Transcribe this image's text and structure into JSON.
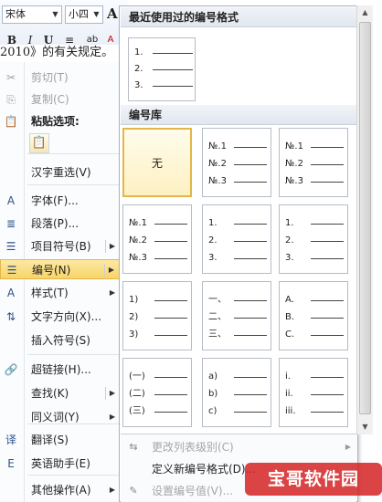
{
  "mini_toolbar": {
    "font": "宋体",
    "size": "小四",
    "grow_font": "A",
    "bold": "B",
    "italic": "I",
    "underline": "U",
    "center": "≡",
    "highlight": "ab",
    "font_color": "A"
  },
  "document": {
    "text": "2010》的有关规定。"
  },
  "context_menu": {
    "items": [
      {
        "label": "剪切(T)",
        "icon": "scissors-icon",
        "glyph": "✂"
      },
      {
        "label": "复制(C)",
        "icon": "copy-icon",
        "glyph": "⎘"
      },
      {
        "label": "粘贴选项:",
        "icon": "clipboard-icon",
        "glyph": "📋"
      },
      {
        "label": "汉字重选(V)",
        "icon": "",
        "glyph": ""
      },
      {
        "label": "字体(F)...",
        "icon": "font-icon",
        "glyph": "A"
      },
      {
        "label": "段落(P)...",
        "icon": "paragraph-icon",
        "glyph": "≣"
      },
      {
        "label": "项目符号(B)",
        "icon": "bullets-icon",
        "glyph": "☰"
      },
      {
        "label": "编号(N)",
        "icon": "numbering-icon",
        "glyph": "☰"
      },
      {
        "label": "样式(T)",
        "icon": "styles-icon",
        "glyph": "A"
      },
      {
        "label": "文字方向(X)...",
        "icon": "text-direction-icon",
        "glyph": "⇅"
      },
      {
        "label": "插入符号(S)",
        "icon": "",
        "glyph": ""
      },
      {
        "label": "超链接(H)...",
        "icon": "hyperlink-icon",
        "glyph": "🔗"
      },
      {
        "label": "查找(K)",
        "icon": "",
        "glyph": ""
      },
      {
        "label": "同义词(Y)",
        "icon": "",
        "glyph": ""
      },
      {
        "label": "翻译(S)",
        "icon": "translate-icon",
        "glyph": "译"
      },
      {
        "label": "英语助手(E)",
        "icon": "english-assistant-icon",
        "glyph": "E"
      },
      {
        "label": "其他操作(A)",
        "icon": "",
        "glyph": ""
      }
    ],
    "paste_keep_glyph": "📋",
    "submenu_arrow": "▶"
  },
  "gallery": {
    "recent_header": "最近使用过的编号格式",
    "library_header": "编号库",
    "recent": [
      "1.",
      "2.",
      "3."
    ],
    "tiles": [
      {
        "none": "无"
      },
      {
        "nums": [
          "№.1",
          "№.2",
          "№.3"
        ]
      },
      {
        "nums": [
          "№.1",
          "№.2",
          "№.3"
        ]
      },
      {
        "nums": [
          "№.1",
          "№.2",
          "№.3"
        ]
      },
      {
        "nums": [
          "1.",
          "2.",
          "3."
        ]
      },
      {
        "nums": [
          "1.",
          "2.",
          "3."
        ]
      },
      {
        "nums": [
          "1)",
          "2)",
          "3)"
        ]
      },
      {
        "nums": [
          "一、",
          "二、",
          "三、"
        ]
      },
      {
        "nums": [
          "A.",
          "B.",
          "C."
        ]
      },
      {
        "nums": [
          "(一)",
          "(二)",
          "(三)"
        ]
      },
      {
        "nums": [
          "a)",
          "b)",
          "c)"
        ]
      },
      {
        "nums": [
          "i.",
          "ii.",
          "iii."
        ]
      }
    ],
    "commands": [
      {
        "label": "更改列表级别(C)",
        "icon": "list-level-icon",
        "glyph": "⇆"
      },
      {
        "label": "定义新编号格式(D)...",
        "icon": "",
        "glyph": ""
      },
      {
        "label": "设置编号值(V)...",
        "icon": "set-value-icon",
        "glyph": "✎"
      }
    ],
    "scroll_up": "▲",
    "scroll_down": "▼"
  },
  "watermark": {
    "text": "宝哥软件园"
  },
  "colors": {
    "highlight": "#fde9a4",
    "watermark": "#d42323",
    "accent": "#e3b647"
  }
}
